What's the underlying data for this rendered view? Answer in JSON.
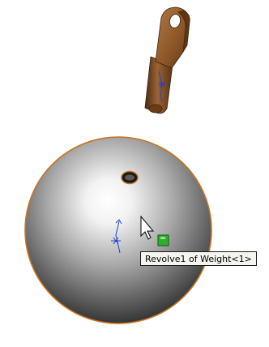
{
  "viewport": {
    "tooltip_text": "Revolve1 of Weight<1>",
    "background_color": "#ffffff",
    "part_edge_color": "#c8731e",
    "pin_color": "#8a5426",
    "sketch_color": "#1f3fd6",
    "handle_color": "#2fae2f"
  }
}
